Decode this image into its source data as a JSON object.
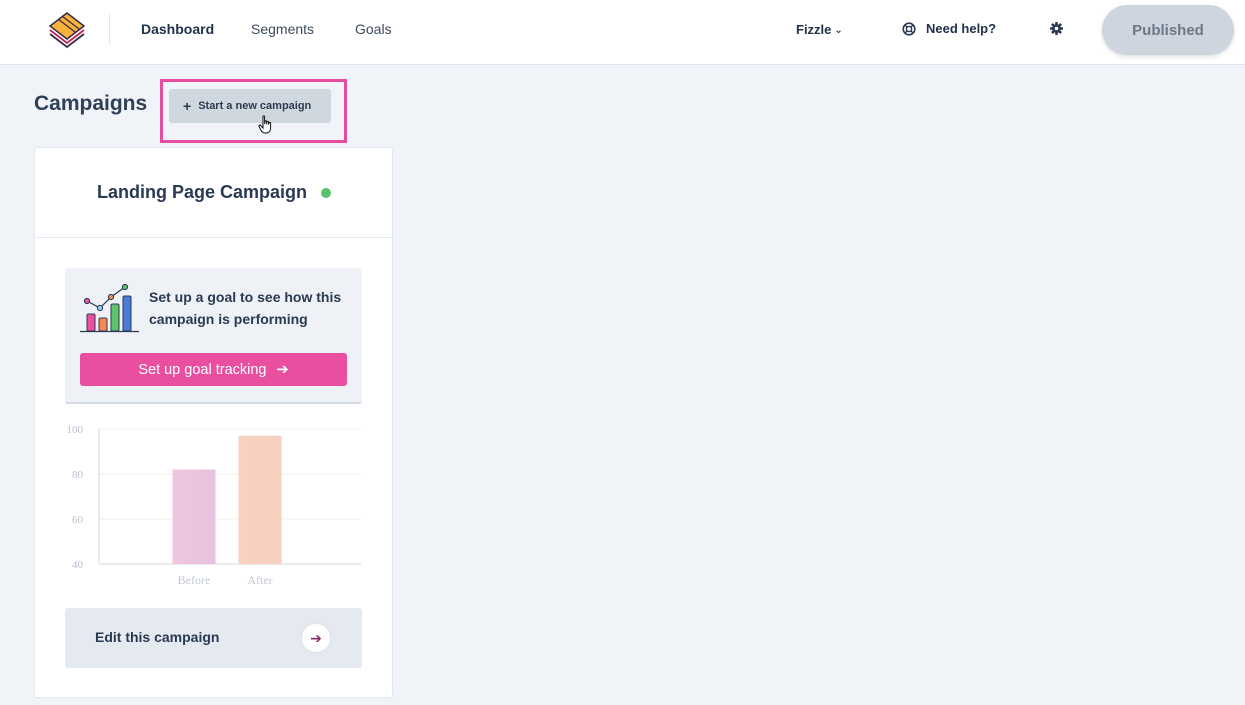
{
  "nav": {
    "items": [
      "Dashboard",
      "Segments",
      "Goals"
    ],
    "account": "Fizzle",
    "help": "Need help?",
    "publish": "Published"
  },
  "page": {
    "title": "Campaigns",
    "new_campaign": "Start a new campaign"
  },
  "campaign": {
    "title": "Landing Page Campaign",
    "status_color": "#59c16b",
    "goal_prompt": "Set up a goal to see how this campaign is performing",
    "goal_button": "Set up goal tracking",
    "edit_label": "Edit this campaign"
  },
  "colors": {
    "accent": "#e94f9e",
    "highlight": "#e64d9f"
  },
  "chart_data": {
    "type": "bar",
    "categories": [
      "Before",
      "After"
    ],
    "values": [
      82,
      97
    ],
    "y_ticks": [
      "100",
      "80",
      "60",
      "40"
    ],
    "ylim": [
      40,
      100
    ],
    "grid": true,
    "colors": [
      "#efc6e0",
      "#f8d2bf"
    ]
  }
}
